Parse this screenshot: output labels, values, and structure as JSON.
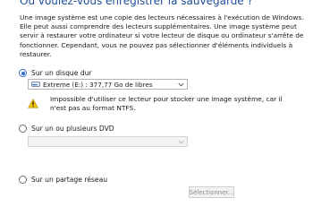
{
  "page": {
    "heading": "Où voulez-vous enregistrer la sauvegarde ?",
    "description": "Une image système est une copie des lecteurs nécessaires à l'exécution de Windows. Elle peut aussi comprendre des lecteurs supplémentaires. Une image système peut servir à restaurer votre ordinateur si votre lecteur de disque ou ordinateur s'arrête de fonctionner. Cependant, vous ne pouvez pas sélectionner d'éléments individuels à restaurer."
  },
  "options": {
    "hard_disk": {
      "label": "Sur un disque dur",
      "selected": true,
      "drive_value": "Extreme (E:) : 377,77 Go de libres",
      "warning": "Impossible d'utiliser ce lecteur pour stocker une image système, car il n'est pas au format NTFS."
    },
    "dvd": {
      "label": "Sur un ou plusieurs DVD",
      "selected": false,
      "drive_value": ""
    },
    "network": {
      "label": "Sur un partage réseau",
      "selected": false,
      "browse_label": "Sélectionner..."
    }
  },
  "colors": {
    "accent": "#2d6dc6",
    "heading": "#1f4e9a",
    "warning": "#f2c200"
  },
  "icons": {
    "drive": "external-drive-icon",
    "warning": "warning-triangle-icon",
    "dropdown": "chevron-down-icon"
  }
}
